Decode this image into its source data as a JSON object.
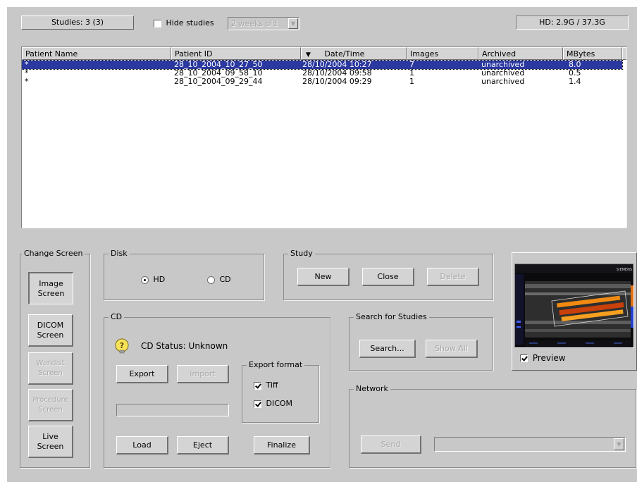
{
  "header": {
    "studies_count": "Studies: 3 (3)",
    "hide_studies_label": "Hide studies",
    "hide_studies_checked": false,
    "age_filter_value": "2 weeks old",
    "hd_usage": "HD: 2.9G / 37.3G"
  },
  "table": {
    "columns": [
      "Patient Name",
      "Patient ID",
      "Date/Time",
      "Images",
      "Archived",
      "MBytes"
    ],
    "sort_column": "Date/Time",
    "sort_direction": "descending",
    "rows": [
      {
        "name": "*",
        "id": "28_10_2004_10_27_50",
        "datetime": "28/10/2004 10:27",
        "images": "7",
        "archived": "unarchived",
        "mbytes": "8.0",
        "selected": true
      },
      {
        "name": "*",
        "id": "28_10_2004_09_58_10",
        "datetime": "28/10/2004 09:58",
        "images": "1",
        "archived": "unarchived",
        "mbytes": "0.5",
        "selected": false
      },
      {
        "name": "*",
        "id": "28_10_2004_09_29_44",
        "datetime": "28/10/2004 09:29",
        "images": "1",
        "archived": "unarchived",
        "mbytes": "1.4",
        "selected": false
      }
    ]
  },
  "change_screen": {
    "title": "Change Screen",
    "image_screen": "Image Screen",
    "dicom_screen": "DICOM Screen",
    "worklist_screen": "Worklist Screen",
    "procedure_screen": "Procedure Screen",
    "live_screen": "Live Screen"
  },
  "disk": {
    "title": "Disk",
    "hd_label": "HD",
    "cd_label": "CD",
    "selected": "HD"
  },
  "study": {
    "title": "Study",
    "new": "New",
    "close": "Close",
    "delete": "Delete"
  },
  "cd": {
    "title": "CD",
    "status": "CD Status: Unknown",
    "export": "Export",
    "import": "Import",
    "progress": 0,
    "load": "Load",
    "eject": "Eject",
    "finalize": "Finalize",
    "export_format": {
      "title": "Export format",
      "tiff": "Tiff",
      "tiff_checked": true,
      "dicom": "DICOM",
      "dicom_checked": true
    }
  },
  "search": {
    "title": "Search for Studies",
    "search": "Search...",
    "show_all": "Show All"
  },
  "preview": {
    "label": "Preview",
    "checked": true,
    "vendor_logo": "SIEMENS"
  },
  "network": {
    "title": "Network",
    "send": "Send",
    "destination_value": ""
  },
  "colors": {
    "selection": "#2a38a0",
    "panel": "#c8c8c8",
    "doppler_flow": "#e87a10"
  },
  "icons": {
    "cd_status": "question-bulb-icon",
    "sort": "sort-descending-icon",
    "dropdown": "dropdown-arrow-icon"
  }
}
